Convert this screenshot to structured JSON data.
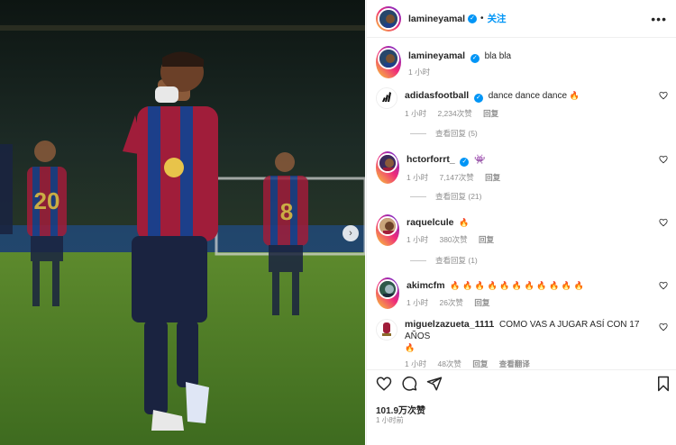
{
  "post": {
    "username": "lamineyamal",
    "follow_label": "关注",
    "more_label": "•••",
    "caption": "bla bla",
    "caption_time": "1 小时",
    "carousel_next": "›"
  },
  "comments": [
    {
      "username": "adidasfootball",
      "text": "dance dance dance",
      "emoji": "🔥",
      "time": "1 小时",
      "likes": "2,234次赞",
      "reply": "回复",
      "view_replies": "查看回复 (5)"
    },
    {
      "username": "hctorforrt_",
      "text": "",
      "emoji": "👾",
      "time": "1 小时",
      "likes": "7,147次赞",
      "reply": "回复",
      "view_replies": "查看回复 (21)"
    },
    {
      "username": "raquelcule",
      "text": "",
      "emoji": "🔥",
      "time": "1 小时",
      "likes": "380次赞",
      "reply": "回复",
      "view_replies": "查看回复 (1)"
    },
    {
      "username": "akimcfm",
      "text": "",
      "emoji": "🔥 🔥 🔥 🔥 🔥 🔥 🔥 🔥 🔥 🔥 🔥",
      "time": "1 小时",
      "likes": "26次赞",
      "reply": "回复"
    },
    {
      "username": "miguelzazueta_1111",
      "text": "COMO VAS A JUGAR ASÍ CON 17 AÑOS",
      "emoji": "🔥",
      "time": "1 小时",
      "likes": "48次赞",
      "reply": "回复",
      "translate": "查看翻译"
    }
  ],
  "footer": {
    "likes": "101.9万次赞",
    "time": "1 小时前"
  },
  "colors": {
    "accent": "#0095f6",
    "text": "#262626",
    "muted": "#8e8e8e",
    "flame": "#f06a1a"
  },
  "icons": [
    "heart-icon",
    "comment-icon",
    "share-icon",
    "bookmark-icon",
    "verified-badge-icon",
    "more-icon"
  ]
}
